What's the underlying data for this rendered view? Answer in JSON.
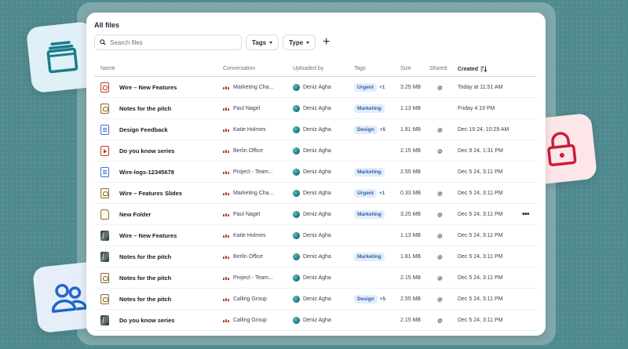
{
  "page": {
    "title": "All files"
  },
  "toolbar": {
    "search_placeholder": "Search files",
    "tags_label": "Tags",
    "type_label": "Type",
    "add_label": "+"
  },
  "table": {
    "columns": {
      "name": "Name",
      "conversation": "Conversation",
      "uploaded_by": "Uploaded by",
      "tags": "Tags",
      "size": "Size",
      "shared": "Shared",
      "created": "Created"
    },
    "rows": [
      {
        "icon": "pdf-file-icon",
        "icon_kind": "pdf",
        "name": "Wire – New Features",
        "conversation": "Marketing Cha...",
        "uploaded_by": "Deniz Agha",
        "tag": "Urgent",
        "tag_more": "+1",
        "size": "3.25 MB",
        "shared": true,
        "created": "Today at 11:51 AM"
      },
      {
        "icon": "image-file-icon",
        "icon_kind": "img",
        "name": "Notes for the pitch",
        "conversation": "Paul Nagel",
        "uploaded_by": "Deniz Agha",
        "tag": "Marketing",
        "tag_more": "",
        "size": "1.13 MB",
        "shared": false,
        "created": "Friday 4:19 PM"
      },
      {
        "icon": "document-file-icon",
        "icon_kind": "doc",
        "name": "Design Feedback",
        "conversation": "Katie Holmes",
        "uploaded_by": "Deniz Agha",
        "tag": "Design",
        "tag_more": "+5",
        "size": "1.81 MB",
        "shared": true,
        "created": "Dec 19 24, 10:29 AM"
      },
      {
        "icon": "video-file-icon",
        "icon_kind": "vid",
        "name": "Do you know series",
        "conversation": "Berlin Office",
        "uploaded_by": "Deniz Agha",
        "tag": "",
        "tag_more": "",
        "size": "2.15 MB",
        "shared": true,
        "created": "Dec 9 24, 1:31 PM"
      },
      {
        "icon": "document-file-icon",
        "icon_kind": "doc",
        "name": "Wire-logs-12345678",
        "conversation": "Project - Team...",
        "uploaded_by": "Deniz Agha",
        "tag": "Marketing",
        "tag_more": "",
        "size": "2.55 MB",
        "shared": false,
        "created": "Dec 5 24, 3:11 PM"
      },
      {
        "icon": "image-file-icon",
        "icon_kind": "img",
        "name": "Wire – Features Slides",
        "conversation": "Marketing Cha...",
        "uploaded_by": "Deniz Agha",
        "tag": "Urgent",
        "tag_more": "+1",
        "size": "0.33 MB",
        "shared": true,
        "created": "Dec 5 24, 3:11 PM"
      },
      {
        "icon": "folder-icon",
        "icon_kind": "folder",
        "name": "New Folder",
        "conversation": "Paul Nagel",
        "uploaded_by": "Deniz Agha",
        "tag": "Marketing",
        "tag_more": "",
        "size": "3.25 MB",
        "shared": true,
        "created": "Dec 5 24, 3:11 PM",
        "more": "•••"
      },
      {
        "icon": "image-thumbnail-icon",
        "icon_kind": "thumb",
        "name": "Wire – New Features",
        "conversation": "Katie Holmes",
        "uploaded_by": "Deniz Agha",
        "tag": "",
        "tag_more": "",
        "size": "1.13 MB",
        "shared": true,
        "created": "Dec 5 24, 3:11 PM"
      },
      {
        "icon": "image-thumbnail-icon",
        "icon_kind": "thumb",
        "name": "Notes for the pitch",
        "conversation": "Berlin Office",
        "uploaded_by": "Deniz Agha",
        "tag": "Marketing",
        "tag_more": "",
        "size": "1.81 MB",
        "shared": true,
        "created": "Dec 5 24, 3:11 PM"
      },
      {
        "icon": "image-file-icon",
        "icon_kind": "img",
        "name": "Notes for the pitch",
        "conversation": "Project - Team...",
        "uploaded_by": "Deniz Agha",
        "tag": "",
        "tag_more": "",
        "size": "2.15 MB",
        "shared": true,
        "created": "Dec 5 24, 3:11 PM"
      },
      {
        "icon": "image-file-icon",
        "icon_kind": "img",
        "name": "Notes for the pitch",
        "conversation": "Calling Group",
        "uploaded_by": "Deniz Agha",
        "tag": "Design",
        "tag_more": "+5",
        "size": "2.55 MB",
        "shared": true,
        "created": "Dec 5 24, 3:11 PM"
      },
      {
        "icon": "image-thumbnail-icon",
        "icon_kind": "thumb",
        "name": "Do you know series",
        "conversation": "Calling Group",
        "uploaded_by": "Deniz Agha",
        "tag": "",
        "tag_more": "",
        "size": "2.15 MB",
        "shared": true,
        "created": "Dec 5 24, 3:11 PM"
      }
    ]
  },
  "decorations": {
    "files_icon": "stacked-files-icon",
    "lock_icon": "lock-icon",
    "users_icon": "users-icon"
  },
  "colors": {
    "background": "#4f8a8e",
    "accent_teal": "#1a7c8e",
    "lock_red": "#c81e3a",
    "users_blue": "#1f66c9",
    "tag_bg": "#e2edf9",
    "tag_text": "#2f5fa8"
  }
}
